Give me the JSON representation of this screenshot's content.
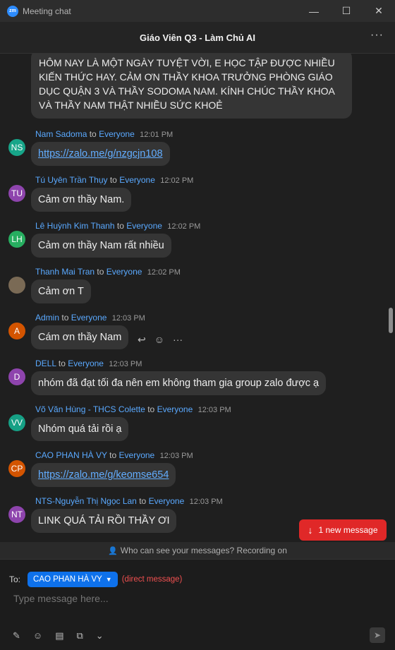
{
  "window": {
    "title": "Meeting chat",
    "logo": "zm",
    "minimize_icon": "—",
    "maximize_icon": "☐",
    "close_icon": "✕"
  },
  "header": {
    "title": "Giáo Viên Q3 - Làm Chủ AI",
    "more_icon": "···"
  },
  "first_message": {
    "text": "HÔM NAY LÀ MỘT NGÀY TUYỆT VỜI, E HỌC TẬP ĐƯỢC NHIỀU KIẾN THỨC HAY. CẢM ƠN THẦY KHOA TRƯỞNG PHÒNG GIÁO DỤC QUẬN 3 VÀ THẦY SODOMA NAM. KÍNH CHÚC THẦY KHOA VÀ THẦY NAM THẬT NHIỀU SỨC KHOẺ"
  },
  "messages": [
    {
      "sender": "Nam Sadoma",
      "to": "to",
      "recipient": "Everyone",
      "time": "12:01 PM",
      "initials": "NS",
      "avatar_color": "#17a589",
      "text": "https://zalo.me/g/nzgcjn108"
    },
    {
      "sender": "Tú Uyên Trần Thụy",
      "to": "to",
      "recipient": "Everyone",
      "time": "12:02 PM",
      "initials": "TU",
      "avatar_color": "#8e44ad",
      "text": "Cảm ơn thầy Nam."
    },
    {
      "sender": "Lê Huỳnh Kim Thanh",
      "to": "to",
      "recipient": "Everyone",
      "time": "12:02 PM",
      "initials": "LH",
      "avatar_color": "#27ae60",
      "text": "Cảm ơn thầy Nam rất nhiều"
    },
    {
      "sender": "Thanh Mai Tran",
      "to": "to",
      "recipient": "Everyone",
      "time": "12:02 PM",
      "initials": "",
      "avatar_color": "#7a6a55",
      "text": "Cảm ơn T"
    },
    {
      "sender": "Admin",
      "to": "to",
      "recipient": "Everyone",
      "time": "12:03 PM",
      "initials": "A",
      "avatar_color": "#d35400",
      "text": "Cám ơn thầy Nam"
    },
    {
      "sender": "DELL",
      "to": "to",
      "recipient": "Everyone",
      "time": "12:03 PM",
      "initials": "D",
      "avatar_color": "#8e44ad",
      "text": "nhóm đã đạt tối đa nên em không tham gia group zalo được ạ"
    },
    {
      "sender": "Võ Văn Hùng - THCS Colette",
      "to": "to",
      "recipient": "Everyone",
      "time": "12:03 PM",
      "initials": "VV",
      "avatar_color": "#16a085",
      "text": "Nhóm quá tải rồi ạ"
    },
    {
      "sender": "CAO PHAN HÀ VY",
      "to": "to",
      "recipient": "Everyone",
      "time": "12:03 PM",
      "initials": "CP",
      "avatar_color": "#d35400",
      "text": "https://zalo.me/g/keomse654"
    },
    {
      "sender": "NTS-Nguyễn Thị Ngọc Lan",
      "to": "to",
      "recipient": "Everyone",
      "time": "12:03 PM",
      "initials": "NT",
      "avatar_color": "#8e44ad",
      "text": "LINK QUÁ TẢI RỒI THẦY ƠI"
    }
  ],
  "reaction_icons": {
    "reply": "↩",
    "emoji": "☺",
    "more": "···"
  },
  "new_message": {
    "label": "1 new message",
    "icon": "↓"
  },
  "privacy": {
    "text": "Who can see your messages? Recording on",
    "icon": "👤"
  },
  "compose": {
    "to_label": "To:",
    "recipient": "CAO PHAN HÀ VY",
    "direct_note": "(direct message)",
    "placeholder": "Type message here...",
    "toolbar_icons": [
      "✎",
      "☺",
      "▤",
      "⧉",
      "⌄"
    ],
    "send_icon": "➤"
  }
}
